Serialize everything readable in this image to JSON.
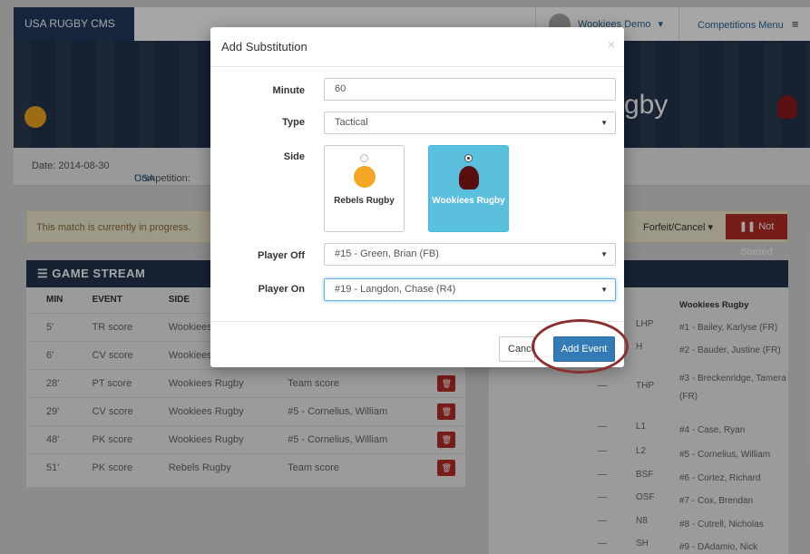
{
  "nav": {
    "brand": "USA RUGBY CMS",
    "user": "Wookiees Demo",
    "user_caret": "▾",
    "competitions": "Competitions Menu",
    "menu_icon": "≡"
  },
  "banner": {
    "title_visible": "gby"
  },
  "info": {
    "date": "Date: 2014-08-30",
    "competition_label": "Competition: ",
    "competition_value": "USA"
  },
  "alert": {
    "message": "This match is currently in progress.",
    "forfeit_label": "Forfeit/Cancel ▾",
    "not_started_label": "Not Started"
  },
  "stream": {
    "title": "GAME STREAM",
    "columns": [
      "MIN",
      "EVENT",
      "SIDE"
    ],
    "rows": [
      {
        "min": "5'",
        "event": "TR score",
        "side": "Wookiees",
        "player": ""
      },
      {
        "min": "6'",
        "event": "CV score",
        "side": "Wookiees",
        "player": ""
      },
      {
        "min": "28'",
        "event": "PT score",
        "side": "Wookiees Rugby",
        "player": "Team score"
      },
      {
        "min": "29'",
        "event": "CV score",
        "side": "Wookiees Rugby",
        "player": "#5 - Cornelius, William"
      },
      {
        "min": "48'",
        "event": "PK score",
        "side": "Wookiees Rugby",
        "player": "#5 - Cornelius, William"
      },
      {
        "min": "51'",
        "event": "PK score",
        "side": "Rebels Rugby",
        "player": "Team score"
      }
    ]
  },
  "roster": {
    "title": "Wookiees Rugby",
    "rows": [
      {
        "dash": "",
        "pos": "LHP",
        "name": "#1 - Bailey, Karlyse (FR)"
      },
      {
        "dash": "",
        "pos": "H",
        "name": "#2 - Bauder, Justine (FR)"
      },
      {
        "dash": "—",
        "pos": "THP",
        "name": "#3 - Breckenridge, Tamera (FR)"
      },
      {
        "dash": "—",
        "pos": "L1",
        "name": "#4 - Case, Ryan"
      },
      {
        "dash": "—",
        "pos": "L2",
        "name": "#5 - Cornelius, William"
      },
      {
        "dash": "—",
        "pos": "BSF",
        "name": "#6 - Cortez, Richard"
      },
      {
        "dash": "—",
        "pos": "OSF",
        "name": "#7 - Cox, Brendan"
      },
      {
        "dash": "—",
        "pos": "N8",
        "name": "#8 - Cutrell, Nicholas"
      },
      {
        "dash": "—",
        "pos": "SH",
        "name": "#9 - DAdamio, Nick"
      }
    ]
  },
  "modal": {
    "title": "Add Substitution",
    "close": "×",
    "minute_label": "Minute",
    "minute_value": "60",
    "type_label": "Type",
    "type_value": "Tactical",
    "side_label": "Side",
    "side_options": [
      "Rebels Rugby",
      "Wookiees Rugby"
    ],
    "side_selected": "Wookiees Rugby",
    "player_off_label": "Player Off",
    "player_off_value": "#15 - Green, Brian (FB)",
    "player_on_label": "Player On",
    "player_on_value": "#19 - Langdon, Chase (R4)",
    "cancel_label": "Cancel",
    "add_label": "Add Event"
  },
  "colors": {
    "navy": "#22344d",
    "primary": "#337ab7",
    "danger": "#b52b27",
    "info": "#5bc0de",
    "annotation": "#8b2f2f"
  }
}
